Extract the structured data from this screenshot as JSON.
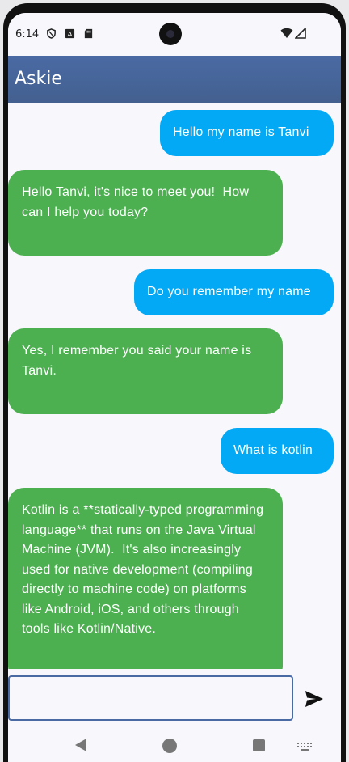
{
  "status_bar": {
    "time": "6:14",
    "icons_left": [
      "shield-icon",
      "a-box-icon",
      "sd-card-icon"
    ],
    "icons_right": [
      "wifi-icon",
      "signal-icon"
    ]
  },
  "app_bar": {
    "title": "Askie",
    "color": "#4a6aa4"
  },
  "chat": {
    "user_color": "#03a9f4",
    "bot_color": "#4caf50",
    "messages": [
      {
        "role": "user",
        "text": "Hello my name is Tanvi"
      },
      {
        "role": "bot",
        "text": "Hello Tanvi, it's nice to meet you!  How can I help you today?"
      },
      {
        "role": "user",
        "text": "Do you remember my name"
      },
      {
        "role": "bot",
        "text": "Yes, I remember you said your name is Tanvi."
      },
      {
        "role": "user",
        "text": "What is kotlin"
      },
      {
        "role": "bot",
        "text": "Kotlin is a **statically-typed programming language** that runs on the Java Virtual Machine (JVM).  It's also increasingly used for native development (compiling directly to machine code) on platforms like Android, iOS, and others through tools like Kotlin/Native."
      }
    ]
  },
  "input": {
    "value": "",
    "placeholder": ""
  },
  "send_icon": "send-icon",
  "nav_bar": {
    "icons": [
      "back-icon",
      "home-icon",
      "recents-icon",
      "keyboard-icon"
    ]
  }
}
